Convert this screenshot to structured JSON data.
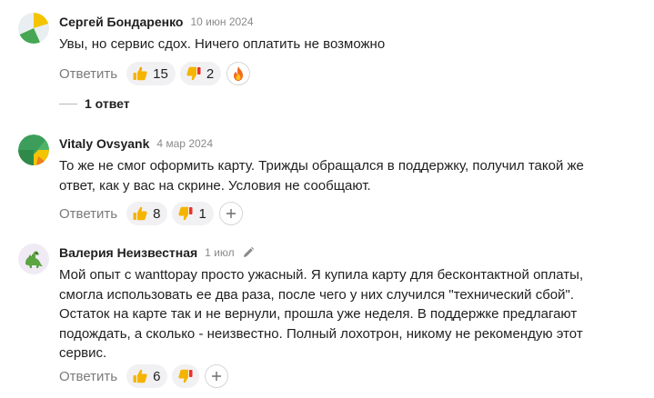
{
  "comments": [
    {
      "author": "Сергей Бондаренко",
      "date": "10 июн 2024",
      "lines": [
        "Увы, но сервис сдох. Ничего оплатить не возможно"
      ],
      "reply_label": "Ответить",
      "likes": "15",
      "dislikes": "2",
      "extra_reaction": "fire-icon",
      "replies_label": "1 ответ"
    },
    {
      "author": "Vitaly Ovsyank",
      "date": "4 мар 2024",
      "lines": [
        "То же не смог оформить карту. Трижды обращался в поддержку, получил такой же",
        "ответ, как у вас на скрине. Условия не сообщают."
      ],
      "reply_label": "Ответить",
      "likes": "8",
      "dislikes": "1",
      "extra_reaction": "plus-icon"
    },
    {
      "author": "Валерия Неизвестная",
      "date": "1 июл",
      "edited_icon": "pencil-icon",
      "lines": [
        "Мой опыт с wanttopay просто ужасный. Я купила карту для бесконтактной оплаты,",
        "смогла использовать ее два раза, после чего у них случился \"технический сбой\".",
        "Остаток на карте так и не вернули, прошла уже неделя. В поддержке предлагают",
        "подождать, а сколько - неизвестно. Полный лохотрон, никому не рекомендую этот",
        "сервис."
      ],
      "reply_label": "Ответить",
      "likes": "6",
      "dislikes": "",
      "extra_reaction": "plus-icon"
    }
  ],
  "colors": {
    "pill_bg": "#f1f1f3",
    "thumb": "#f5b400",
    "thumb_down_accent": "#e8322d",
    "muted_text": "#7a7a7a"
  }
}
